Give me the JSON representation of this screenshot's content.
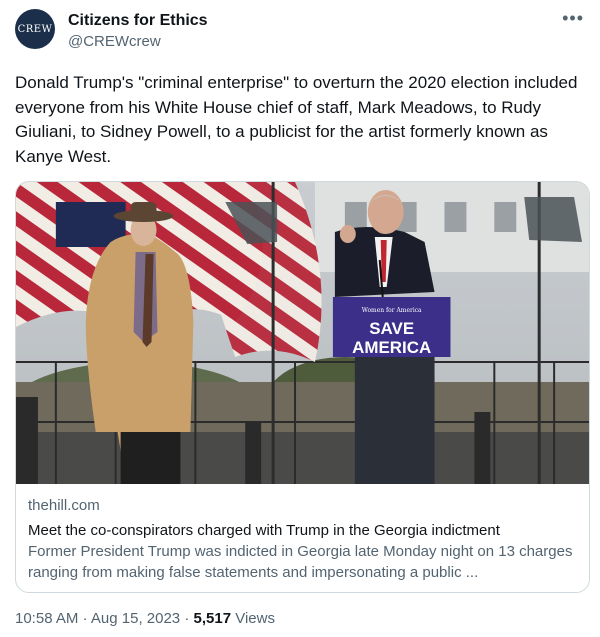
{
  "author": {
    "name": "Citizens for Ethics",
    "handle": "@CREWcrew",
    "avatar_text": "CREW"
  },
  "more_icon": "more-horizontal-icon",
  "tweet": {
    "text": "Donald Trump's \"criminal enterprise\" to overturn the 2020 election included everyone from his White House chief of staff, Mark Meadows, to Rudy Giuliani, to Sidney Powell, to a publicist for the artist formerly known as Kanye West."
  },
  "card": {
    "domain": "thehill.com",
    "title": "Meet the co-conspirators charged with Trump in the Georgia indictment",
    "description": "Former President Trump was indicted in Georgia late Monday night on 13 charges ranging from making false statements and impersonating a public ...",
    "image": {
      "podium_line1": "SAVE",
      "podium_line2": "AMERICA",
      "podium_small": "Women for America"
    }
  },
  "footer": {
    "time": "10:58 AM",
    "date": "Aug 15, 2023",
    "views_count": "5,517",
    "views_label": "Views"
  },
  "colors": {
    "text": "#0f1419",
    "secondary": "#536471",
    "border": "#cfd9de",
    "avatar_bg": "#1b2f4a",
    "podium": "#3b2f8a"
  }
}
